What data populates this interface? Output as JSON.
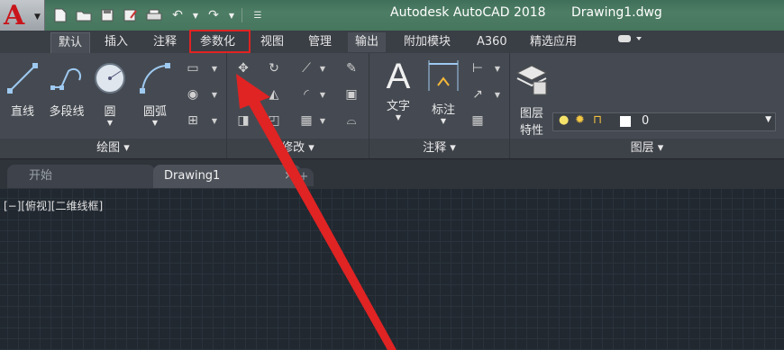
{
  "window": {
    "app_title": "Autodesk AutoCAD 2018",
    "doc_title": "Drawing1.dwg"
  },
  "app_button": {
    "logo_letter": "A"
  },
  "tabs": [
    {
      "label": "默认"
    },
    {
      "label": "插入"
    },
    {
      "label": "注释"
    },
    {
      "label": "参数化"
    },
    {
      "label": "视图"
    },
    {
      "label": "管理"
    },
    {
      "label": "输出"
    },
    {
      "label": "附加模块"
    },
    {
      "label": "A360"
    },
    {
      "label": "精选应用"
    }
  ],
  "draw_panel": {
    "tools": [
      {
        "label": "直线"
      },
      {
        "label": "多段线"
      },
      {
        "label": "圆"
      },
      {
        "label": "圆弧"
      }
    ],
    "footer": "绘图"
  },
  "modify_panel": {
    "footer": "修改"
  },
  "annotation_panel": {
    "tools": [
      {
        "label": "文字"
      },
      {
        "label": "标注"
      }
    ],
    "footer": "注释"
  },
  "layers_panel": {
    "tool_label_line1": "图层",
    "tool_label_line2": "特性",
    "current_layer": "0",
    "footer": "图层"
  },
  "doc_tabs": [
    {
      "label": "开始"
    },
    {
      "label": "Drawing1"
    }
  ],
  "doc_tab_close": "×",
  "doc_tab_add": "+",
  "viewport_label": "[−][俯视][二维线框]",
  "colors": {
    "highlight": "#e02323",
    "logo_red": "#c8151b",
    "ribbon_bg": "#454a52",
    "canvas_bg": "#212830"
  }
}
